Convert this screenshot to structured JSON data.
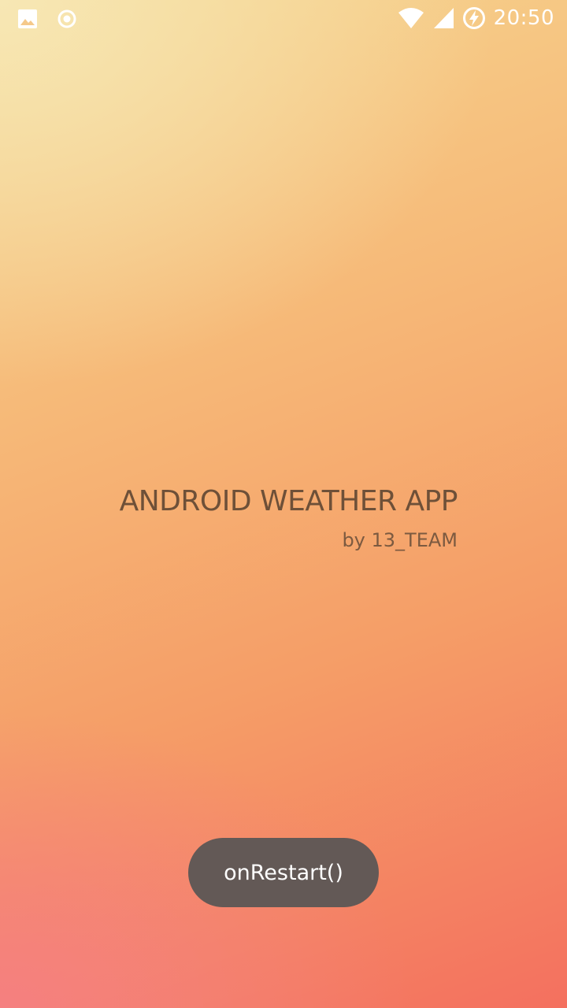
{
  "status_bar": {
    "time": "20:50",
    "left_icons": [
      "image-icon",
      "record-icon"
    ],
    "right_icons": [
      "wifi-icon",
      "signal-icon",
      "battery-charging-icon"
    ]
  },
  "splash": {
    "title": "ANDROID WEATHER APP",
    "subtitle": "by 13_TEAM"
  },
  "toast": {
    "message": "onRestart()"
  },
  "colors": {
    "title_text": "#6e5038",
    "toast_bg": "#635956",
    "gradient_top": "#f7e7b4",
    "gradient_bottom": "#f4705f"
  }
}
